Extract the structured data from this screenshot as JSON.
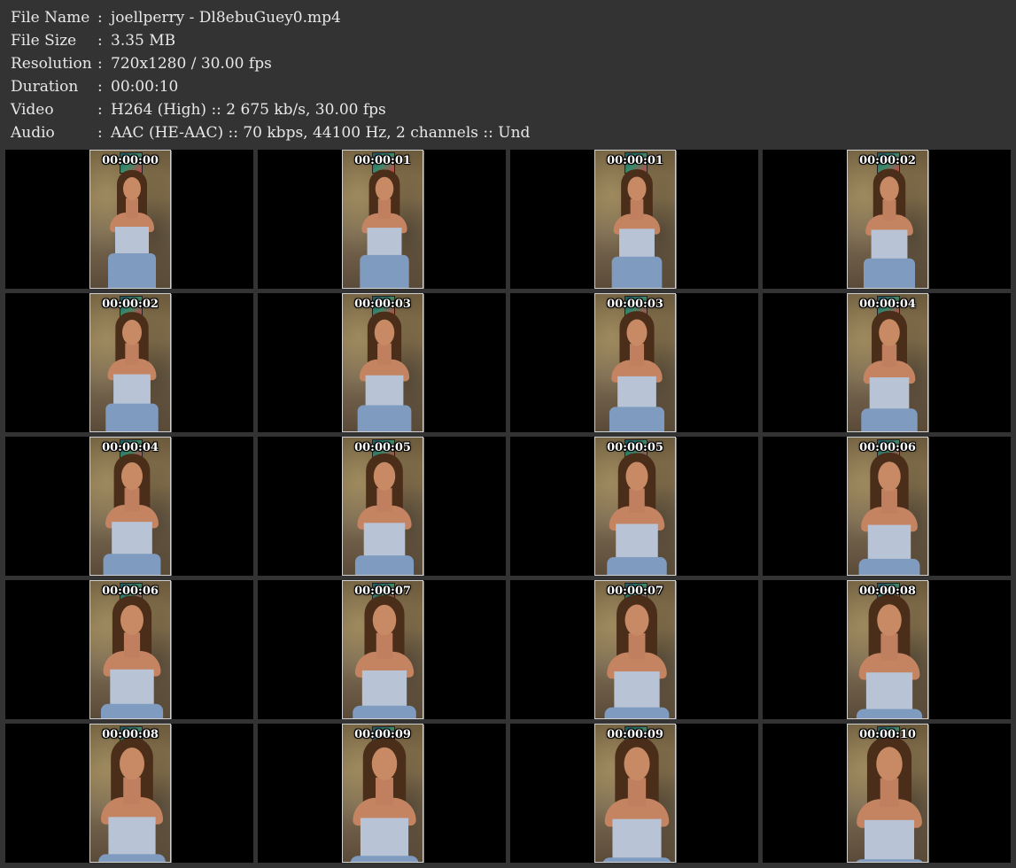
{
  "info": [
    {
      "key": "File Name",
      "sep": ":",
      "value": "joellperry - Dl8ebuGuey0.mp4"
    },
    {
      "key": "File Size",
      "sep": ":",
      "value": "3.35 MB"
    },
    {
      "key": "Resolution",
      "sep": ":",
      "value": "720x1280 / 30.00 fps"
    },
    {
      "key": "Duration",
      "sep": ":",
      "value": "00:00:10"
    },
    {
      "key": "Video",
      "sep": ":",
      "value": "H264 (High) :: 2 675 kb/s, 30.00 fps"
    },
    {
      "key": "Audio",
      "sep": ":",
      "value": "AAC (HE-AAC) :: 70 kbps, 44100 Hz, 2 channels :: Und"
    }
  ],
  "thumbnails": [
    {
      "timestamp": "00:00:00"
    },
    {
      "timestamp": "00:00:01"
    },
    {
      "timestamp": "00:00:01"
    },
    {
      "timestamp": "00:00:02"
    },
    {
      "timestamp": "00:00:02"
    },
    {
      "timestamp": "00:00:03"
    },
    {
      "timestamp": "00:00:03"
    },
    {
      "timestamp": "00:00:04"
    },
    {
      "timestamp": "00:00:04"
    },
    {
      "timestamp": "00:00:05"
    },
    {
      "timestamp": "00:00:05"
    },
    {
      "timestamp": "00:00:06"
    },
    {
      "timestamp": "00:00:06"
    },
    {
      "timestamp": "00:00:07"
    },
    {
      "timestamp": "00:00:07"
    },
    {
      "timestamp": "00:00:08"
    },
    {
      "timestamp": "00:00:08"
    },
    {
      "timestamp": "00:00:09"
    },
    {
      "timestamp": "00:00:09"
    },
    {
      "timestamp": "00:00:10"
    }
  ],
  "colors": {
    "background": "#333333",
    "text": "#e8e8e8",
    "cell": "#000000",
    "timestamp": "#ffffff"
  }
}
